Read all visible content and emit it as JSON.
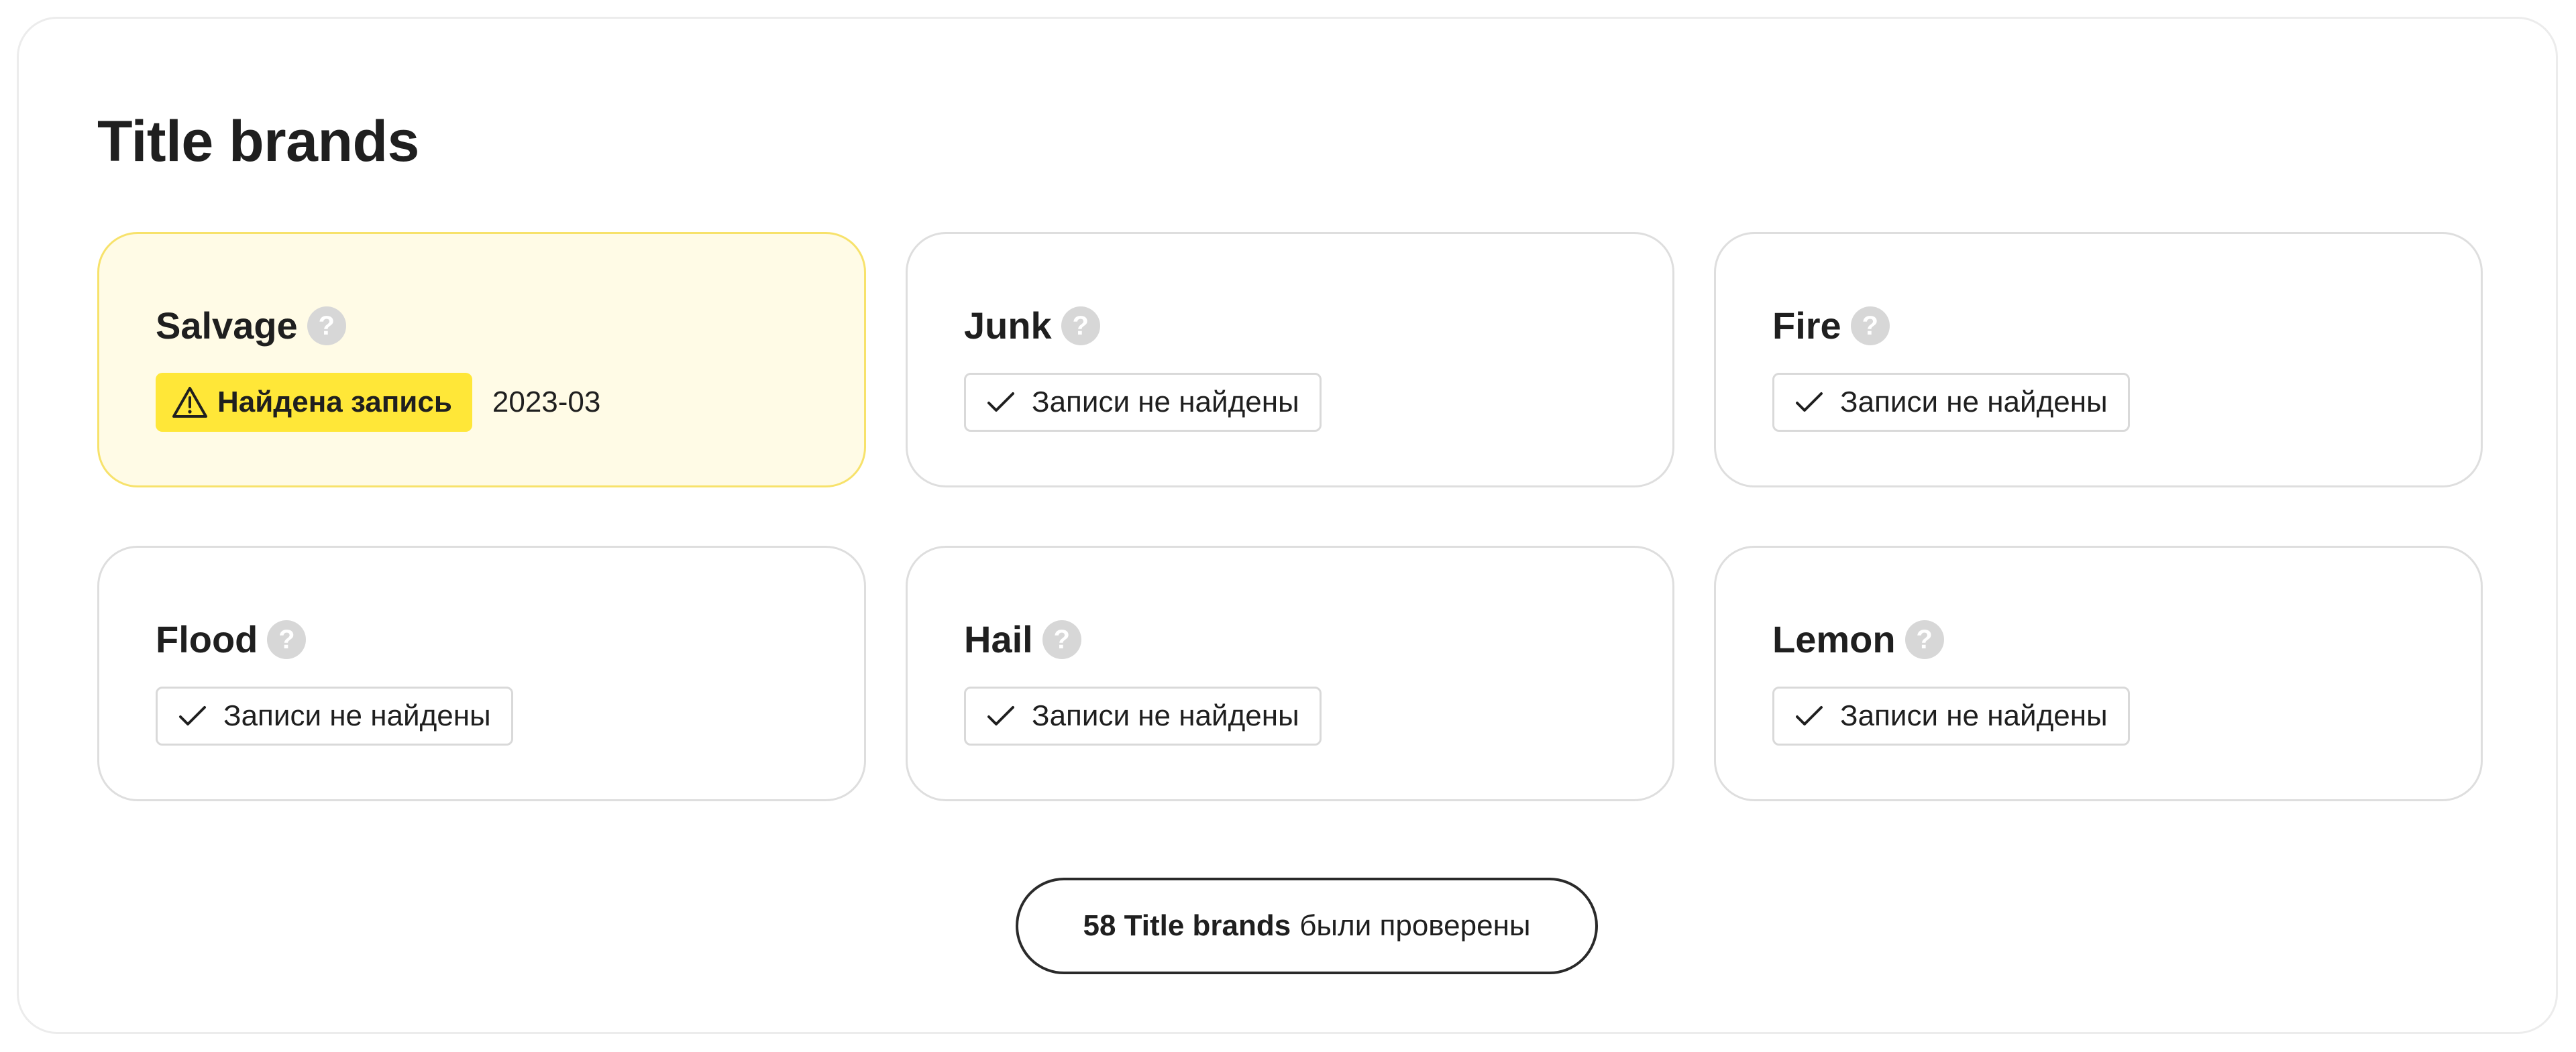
{
  "section": {
    "title": "Title brands"
  },
  "brands": [
    {
      "name": "Salvage",
      "status": "found",
      "status_label": "Найдена запись",
      "date": "2023-03"
    },
    {
      "name": "Junk",
      "status": "clean",
      "status_label": "Записи не найдены"
    },
    {
      "name": "Fire",
      "status": "clean",
      "status_label": "Записи не найдены"
    },
    {
      "name": "Flood",
      "status": "clean",
      "status_label": "Записи не найдены"
    },
    {
      "name": "Hail",
      "status": "clean",
      "status_label": "Записи не найдены"
    },
    {
      "name": "Lemon",
      "status": "clean",
      "status_label": "Записи не найдены"
    }
  ],
  "help_glyph": "?",
  "summary": {
    "count_text": "58 Title brands",
    "suffix_text": "были проверены"
  },
  "colors": {
    "warning_badge": "#ffe738",
    "alert_card_background": "#fffbe6",
    "alert_card_border": "#f7e26b"
  },
  "icons": {
    "warning": "warning-triangle-icon",
    "ok": "checkmark-icon",
    "help": "help-circle-icon"
  }
}
